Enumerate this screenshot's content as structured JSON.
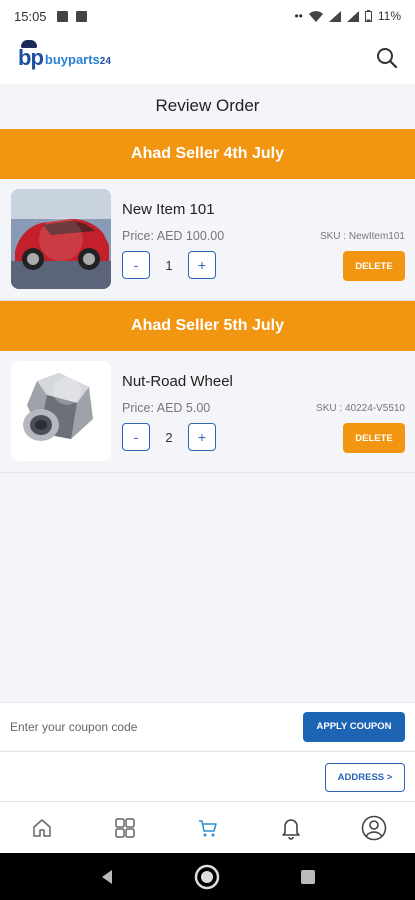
{
  "status_bar": {
    "time": "15:05",
    "battery": "11%"
  },
  "app": {
    "logo_mark": "bp",
    "logo_text": "buyparts",
    "logo_num": "24"
  },
  "page": {
    "title": "Review Order"
  },
  "groups": [
    {
      "seller": "Ahad Seller 4th July",
      "item": {
        "name": "New Item 101",
        "price": "Price: AED 100.00",
        "sku": "SKU : NewItem101",
        "qty": "1",
        "minus": "-",
        "plus": "+",
        "delete_label": "DELETE",
        "thumb": "red-car"
      }
    },
    {
      "seller": "Ahad Seller 5th July",
      "item": {
        "name": "Nut-Road Wheel",
        "price": "Price: AED 5.00",
        "sku": "SKU : 40224-V5510",
        "qty": "2",
        "minus": "-",
        "plus": "+",
        "delete_label": "DELETE",
        "thumb": "wheel-nut"
      }
    }
  ],
  "coupon": {
    "placeholder": "Enter your coupon code",
    "apply_label": "APPLY COUPON"
  },
  "address": {
    "label": "ADDRESS >"
  },
  "bottom_nav": [
    "home-icon",
    "categories-icon",
    "cart-icon",
    "bell-icon",
    "profile-icon"
  ],
  "colors": {
    "accent_orange": "#f29612",
    "accent_blue": "#1e64b4",
    "nav_active": "#2a8fd6"
  }
}
